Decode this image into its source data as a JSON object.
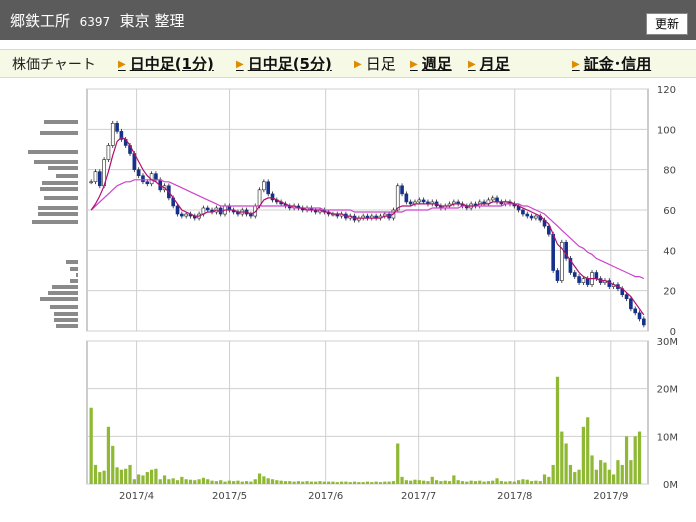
{
  "header": {
    "company": "郷鉄工所",
    "code": "6397",
    "market": "東京",
    "status": "整理",
    "update_label": "更新"
  },
  "nav": {
    "label": "株価チャート",
    "items": [
      {
        "label": "日中足(1分)",
        "link": true
      },
      {
        "label": "日中足(5分)",
        "link": true
      },
      {
        "label": "日足",
        "link": false
      },
      {
        "label": "週足",
        "link": true
      },
      {
        "label": "月足",
        "link": true
      },
      {
        "label": "証金･信用",
        "link": true
      }
    ]
  },
  "colors": {
    "up": "#ffffff",
    "down": "#15318c",
    "ma": "#cc44cc",
    "volume": "#8fb935",
    "grid": "#cfcfcf"
  },
  "chart_data": [
    {
      "type": "candlestick",
      "ylim": [
        0,
        120
      ],
      "yticks": [
        "0",
        "20",
        "40",
        "60",
        "80",
        "100",
        "120"
      ],
      "xticks": [
        "2017/4",
        "2017/5",
        "2017/6",
        "2017/7",
        "2017/8",
        "2017/9"
      ],
      "x_range": [
        "2017-03-16",
        "2017-09-13"
      ],
      "close": [
        74,
        79,
        72,
        85,
        92,
        103,
        99,
        95,
        92,
        88,
        80,
        77,
        74,
        73,
        78,
        75,
        70,
        72,
        66,
        62,
        58,
        57,
        58,
        57,
        56,
        58,
        61,
        60,
        59,
        61,
        58,
        62,
        60,
        59,
        58,
        60,
        58,
        57,
        62,
        70,
        74,
        68,
        65,
        64,
        63,
        62,
        61,
        62,
        61,
        60,
        61,
        60,
        59,
        60,
        59,
        58,
        58,
        57,
        58,
        56,
        57,
        55,
        56,
        57,
        56,
        57,
        56,
        57,
        58,
        56,
        60,
        72,
        68,
        64,
        63,
        64,
        65,
        64,
        63,
        64,
        62,
        61,
        62,
        63,
        64,
        63,
        62,
        61,
        63,
        62,
        64,
        63,
        65,
        66,
        64,
        63,
        64,
        63,
        62,
        60,
        58,
        57,
        56,
        57,
        55,
        52,
        48,
        30,
        25,
        44,
        36,
        29,
        27,
        24,
        26,
        23,
        29,
        26,
        24,
        25,
        22,
        23,
        21,
        18,
        16,
        11,
        9,
        6,
        3
      ],
      "ma_short": [
        60,
        63,
        67,
        72,
        79,
        87,
        94,
        96,
        95,
        92,
        88,
        84,
        80,
        77,
        75,
        74,
        72,
        71,
        69,
        66,
        63,
        60,
        59,
        58,
        57,
        57,
        58,
        59,
        59,
        60,
        59,
        60,
        60,
        60,
        59,
        59,
        59,
        58,
        59,
        62,
        65,
        66,
        66,
        65,
        64,
        63,
        62,
        62,
        61,
        61,
        60,
        60,
        60,
        60,
        59,
        59,
        58,
        58,
        58,
        57,
        57,
        56,
        56,
        56,
        56,
        56,
        56,
        56,
        57,
        57,
        58,
        61,
        62,
        62,
        62,
        63,
        63,
        63,
        63,
        63,
        63,
        62,
        62,
        62,
        63,
        63,
        63,
        62,
        62,
        62,
        63,
        63,
        63,
        64,
        64,
        64,
        64,
        64,
        63,
        62,
        61,
        60,
        59,
        58,
        57,
        55,
        53,
        48,
        43,
        41,
        38,
        35,
        32,
        29,
        27,
        26,
        26,
        26,
        25,
        25,
        24,
        23,
        22,
        21,
        19,
        17,
        14,
        11,
        8
      ],
      "ma_long": [
        60,
        62,
        64,
        66,
        68,
        70,
        72,
        73,
        74,
        74,
        75,
        75,
        75,
        75,
        75,
        75,
        75,
        74,
        74,
        73,
        72,
        71,
        70,
        69,
        68,
        67,
        66,
        65,
        64,
        63,
        62,
        62,
        62,
        62,
        62,
        62,
        62,
        62,
        62,
        62,
        62,
        62,
        62,
        62,
        62,
        62,
        62,
        61,
        61,
        61,
        61,
        61,
        61,
        61,
        60,
        60,
        60,
        60,
        60,
        60,
        60,
        59,
        59,
        59,
        59,
        59,
        59,
        59,
        59,
        59,
        59,
        59,
        59,
        60,
        60,
        60,
        60,
        60,
        60,
        61,
        61,
        61,
        61,
        61,
        61,
        61,
        62,
        62,
        62,
        62,
        62,
        62,
        62,
        62,
        62,
        62,
        63,
        63,
        63,
        63,
        62,
        62,
        61,
        60,
        59,
        58,
        56,
        54,
        52,
        50,
        48,
        46,
        44,
        42,
        41,
        39,
        38,
        36,
        35,
        34,
        33,
        32,
        31,
        30,
        29,
        28,
        27,
        27,
        26
      ],
      "unit": ""
    },
    {
      "type": "bar",
      "ylim": [
        0,
        30
      ],
      "yticks": [
        "0M",
        "10M",
        "20M",
        "30M"
      ],
      "values": [
        16,
        4,
        2.5,
        2.8,
        12,
        8,
        3.5,
        3,
        3.2,
        4,
        1,
        2,
        1.8,
        2.5,
        3,
        3.2,
        1,
        1.8,
        1,
        1.2,
        0.8,
        1.5,
        1,
        0.9,
        0.8,
        1,
        1.3,
        1,
        0.7,
        0.6,
        0.8,
        0.5,
        0.7,
        0.6,
        0.7,
        0.5,
        0.6,
        0.5,
        1,
        2.2,
        1.6,
        1.2,
        1,
        0.8,
        0.7,
        0.6,
        0.6,
        0.5,
        0.6,
        0.5,
        0.6,
        0.5,
        0.5,
        0.6,
        0.5,
        0.5,
        0.5,
        0.4,
        0.5,
        0.5,
        0.4,
        0.5,
        0.4,
        0.4,
        0.5,
        0.4,
        0.5,
        0.4,
        0.5,
        0.5,
        0.6,
        8.5,
        1.5,
        0.8,
        0.7,
        0.9,
        0.8,
        0.7,
        0.6,
        1.5,
        0.8,
        0.6,
        0.7,
        0.6,
        1.8,
        0.8,
        0.6,
        0.5,
        0.7,
        0.6,
        0.7,
        0.5,
        0.6,
        0.7,
        1.2,
        0.6,
        0.5,
        0.6,
        0.5,
        0.8,
        1,
        0.9,
        0.6,
        0.7,
        0.6,
        2,
        1.5,
        4,
        22.5,
        11,
        8.5,
        4,
        2.5,
        3,
        12,
        14,
        6,
        3,
        5,
        4.5,
        3,
        2,
        5,
        4,
        10,
        5,
        10,
        11
      ],
      "unit": "M"
    }
  ]
}
